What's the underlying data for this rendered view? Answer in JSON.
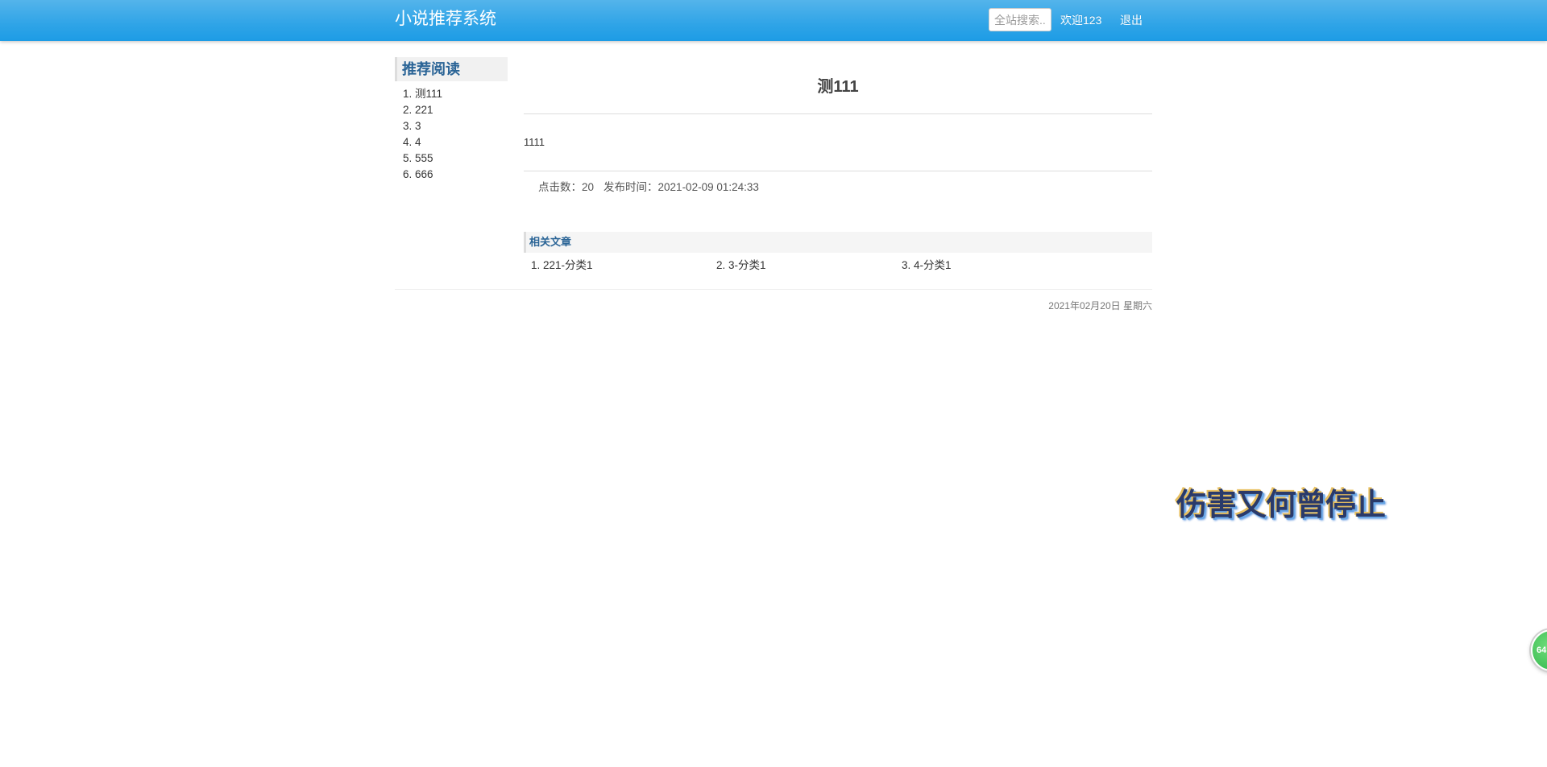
{
  "header": {
    "brand": "小说推荐系统",
    "search_placeholder": "全站搜索..",
    "welcome": "欢迎123",
    "logout": "退出"
  },
  "sidebar": {
    "title": "推荐阅读",
    "items": [
      {
        "label": "1. 测111"
      },
      {
        "label": "2. 221"
      },
      {
        "label": "3. 3"
      },
      {
        "label": "4. 4"
      },
      {
        "label": "5. 555"
      },
      {
        "label": "6. 666"
      }
    ]
  },
  "article": {
    "title": "测111",
    "body": "1111",
    "clicks": "点击数：20",
    "published": "发布时间：2021-02-09 01:24:33"
  },
  "related": {
    "title": "相关文章",
    "items": [
      {
        "label": "1. 221-分类1"
      },
      {
        "label": "2. 3-分类1"
      },
      {
        "label": "3. 4-分类1"
      }
    ]
  },
  "footer": {
    "date": "2021年02月20日 星期六"
  },
  "overlay": {
    "text": "伤害又何曾停止"
  },
  "badge": {
    "text": "64"
  }
}
